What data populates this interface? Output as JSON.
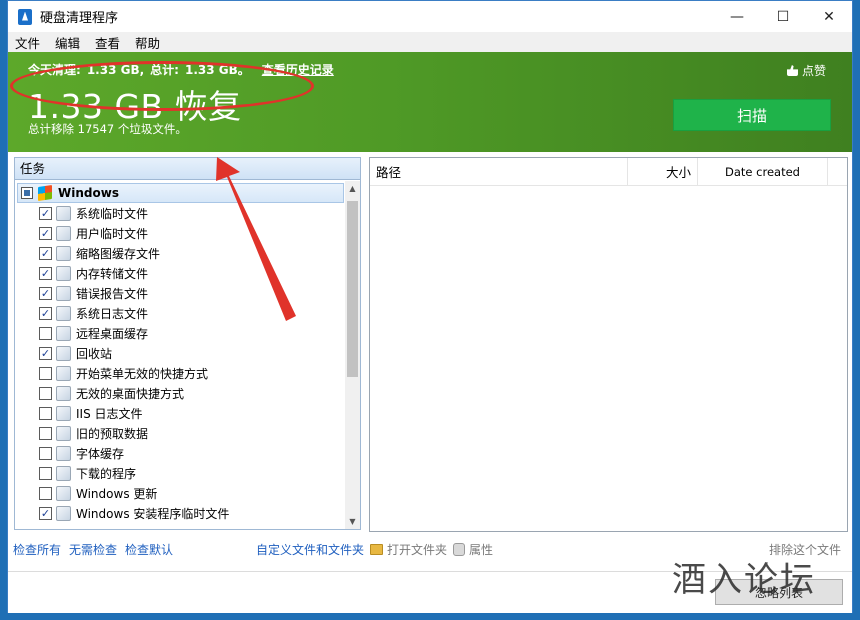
{
  "window": {
    "title": "硬盘清理程序",
    "minimize": "—",
    "maximize": "☐",
    "close": "✕"
  },
  "menu": [
    "文件",
    "编辑",
    "查看",
    "帮助"
  ],
  "banner": {
    "today_prefix": "今天清理:",
    "today_value": "1.33 GB,",
    "total_prefix": "总计:",
    "total_value": "1.33 GB。",
    "history_link": "查看历史记录",
    "recovered": "1.33 GB 恢复",
    "total_removed": "总计移除 17547 个垃圾文件。",
    "like": "点赞",
    "scan_button": "扫描"
  },
  "tasks": {
    "header": "任务",
    "group": "Windows",
    "items": [
      {
        "label": "系统临时文件",
        "checked": true
      },
      {
        "label": "用户临时文件",
        "checked": true
      },
      {
        "label": "缩略图缓存文件",
        "checked": true
      },
      {
        "label": "内存转储文件",
        "checked": true
      },
      {
        "label": "错误报告文件",
        "checked": true
      },
      {
        "label": "系统日志文件",
        "checked": true
      },
      {
        "label": "远程桌面缓存",
        "checked": false
      },
      {
        "label": "回收站",
        "checked": true
      },
      {
        "label": "开始菜单无效的快捷方式",
        "checked": false
      },
      {
        "label": "无效的桌面快捷方式",
        "checked": false
      },
      {
        "label": "IIS 日志文件",
        "checked": false
      },
      {
        "label": "旧的预取数据",
        "checked": false
      },
      {
        "label": "字体缓存",
        "checked": false
      },
      {
        "label": "下载的程序",
        "checked": false
      },
      {
        "label": "Windows 更新",
        "checked": false
      },
      {
        "label": "Windows 安装程序临时文件",
        "checked": true
      }
    ]
  },
  "results": {
    "col_path": "路径",
    "col_size": "大小",
    "col_date": "Date created"
  },
  "bottom": {
    "check_all": "检查所有",
    "no_check": "无需检查",
    "check_default": "检查默认",
    "custom": "自定义文件和文件夹",
    "open_folder": "打开文件夹",
    "properties": "属性",
    "exclude": "排除这个文件",
    "ignore_list": "忽略列表"
  },
  "watermark": "酒入论坛",
  "colors": {
    "banner": "#4f9a26",
    "scan": "#1fb34a",
    "annotation": "#e0332a"
  }
}
